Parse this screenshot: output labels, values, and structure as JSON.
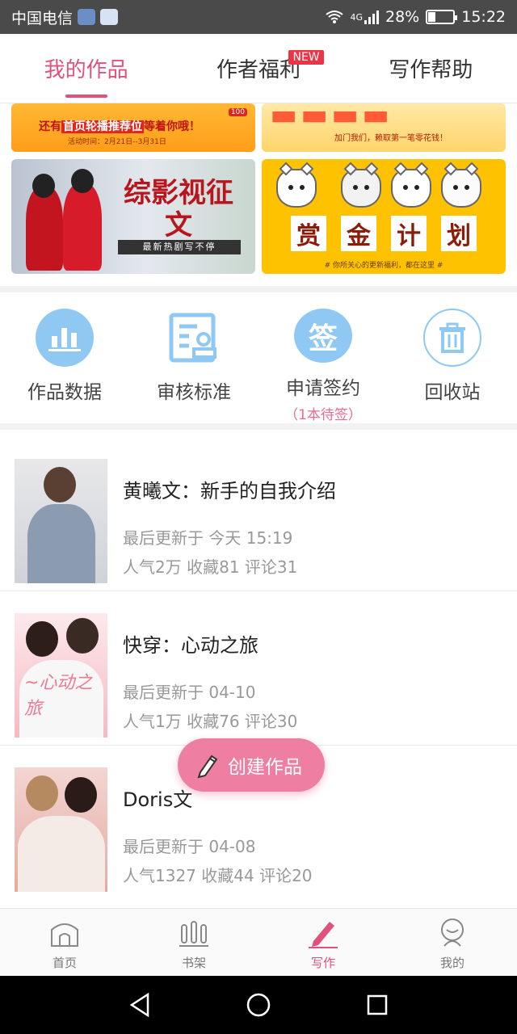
{
  "status_bar": {
    "carrier": "中国电信",
    "network": "4G",
    "battery": "28%",
    "battery_level": 0.28,
    "time": "15:22"
  },
  "top_tabs": [
    {
      "label": "我的作品",
      "active": true
    },
    {
      "label": "作者福利",
      "active": false,
      "badge": "NEW"
    },
    {
      "label": "写作帮助",
      "active": false
    }
  ],
  "banners": {
    "b1": {
      "text_prefix": "还有",
      "text_highlight": "首页轮播推荐位",
      "text_suffix": "等着你哦！",
      "date": "活动时间：2月21日--3月31日",
      "tag": "100"
    },
    "b2": {
      "text": "加门我们，赖取第一笔零花钱！"
    },
    "b3": {
      "title": "综影视征文",
      "sub": "最新热剧写不停"
    },
    "b4": {
      "chars": [
        "赏",
        "金",
        "计",
        "划"
      ],
      "sub": "# 你所关心的更新福利，都在这里 #"
    }
  },
  "actions": [
    {
      "label": "作品数据",
      "icon": "bar-chart-icon"
    },
    {
      "label": "审核标准",
      "icon": "review-document-icon"
    },
    {
      "label": "申请签约",
      "icon": "sign-badge-icon",
      "sub": "（1本待签）"
    },
    {
      "label": "回收站",
      "icon": "trash-icon"
    }
  ],
  "sign_icon_char": "签",
  "works": [
    {
      "title": "黄曦文：新手的自我介绍",
      "updated": "最后更新于 今天 15:19",
      "popularity": "人气2万",
      "favorites": "收藏81",
      "comments": "评论31"
    },
    {
      "title": "快穿：心动之旅",
      "updated": "最后更新于 04-10",
      "popularity": "人气1万",
      "favorites": "收藏76",
      "comments": "评论30"
    },
    {
      "title": "Doris文",
      "updated": "最后更新于 04-08",
      "popularity": "人气1327",
      "favorites": "收藏44",
      "comments": "评论20"
    }
  ],
  "fab": {
    "label": "创建作品"
  },
  "bottom_nav": [
    {
      "label": "首页",
      "active": false
    },
    {
      "label": "书架",
      "active": false
    },
    {
      "label": "写作",
      "active": true
    },
    {
      "label": "我的",
      "active": false
    }
  ],
  "colors": {
    "accent": "#e0527c",
    "icon_blue": "#8fc9f3",
    "fab": "#ee7ea2"
  }
}
